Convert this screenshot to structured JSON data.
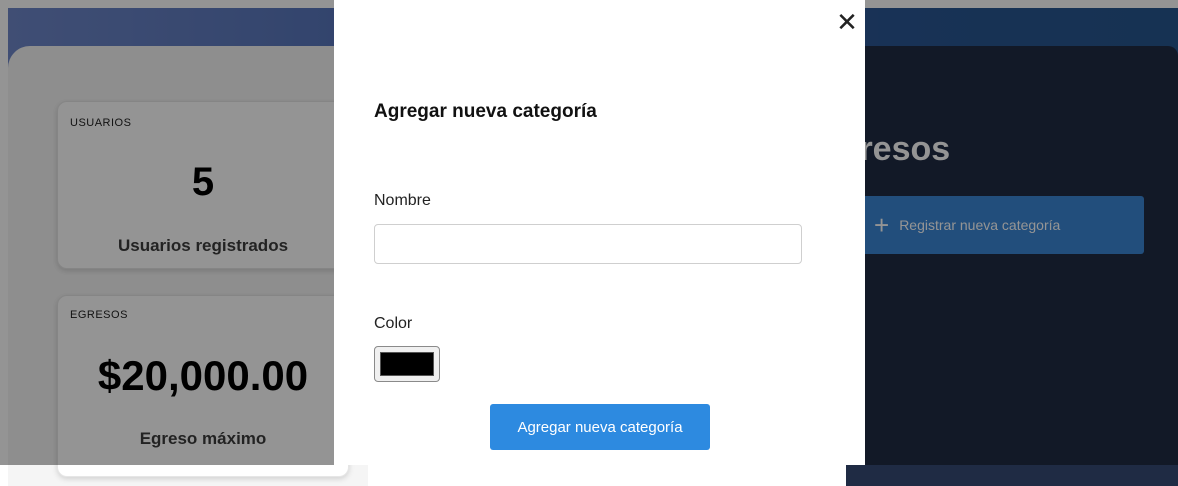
{
  "dashboard": {
    "cards": [
      {
        "kicker": "USUARIOS",
        "value": "5",
        "caption": "Usuarios registrados"
      },
      {
        "kicker": "EGRESOS",
        "value": "$20,000.00",
        "caption": "Egreso máximo"
      }
    ],
    "section_title": "Egresos",
    "register_button": {
      "icon": "plus-icon",
      "label": "Registrar nueva categoría"
    }
  },
  "modal": {
    "close_icon": "close-icon",
    "title": "Agregar nueva categoría",
    "name_label": "Nombre",
    "name_value": "",
    "color_label": "Color",
    "color_value": "#000000",
    "submit_label": "Agregar nueva categoría"
  },
  "colors": {
    "accent": "#2d8ae0",
    "dark_panel": "#1f2b44"
  }
}
